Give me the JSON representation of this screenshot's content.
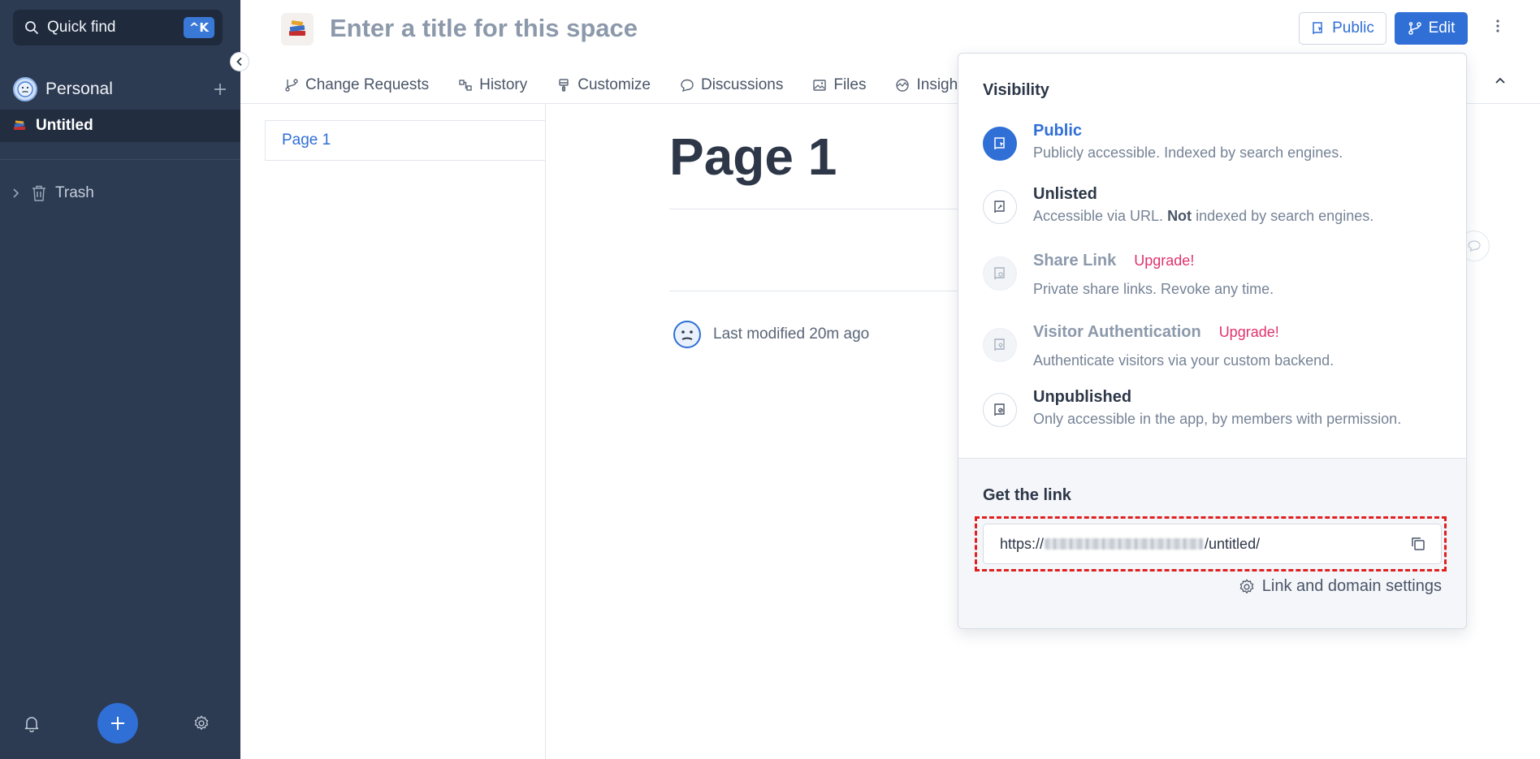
{
  "sidebar": {
    "quick_find": "Quick find",
    "shortcut": "^K",
    "section_name": "Personal",
    "item_untitled": "Untitled",
    "trash": "Trash"
  },
  "header": {
    "title_placeholder": "Enter a title for this space",
    "public_button": "Public",
    "edit_button": "Edit"
  },
  "tabs": [
    {
      "label": "Change Requests",
      "icon": "branch-icon"
    },
    {
      "label": "History",
      "icon": "history-icon"
    },
    {
      "label": "Customize",
      "icon": "brush-icon"
    },
    {
      "label": "Discussions",
      "icon": "chat-icon"
    },
    {
      "label": "Files",
      "icon": "image-icon"
    },
    {
      "label": "Insigh",
      "icon": "insights-icon"
    }
  ],
  "page_tree": {
    "item": "Page 1"
  },
  "content": {
    "heading": "Page 1",
    "last_modified": "Last modified 20m ago"
  },
  "visibility": {
    "heading": "Visibility",
    "options": [
      {
        "title": "Public",
        "desc": "Publicly accessible. Indexed by search engines.",
        "state": "active"
      },
      {
        "title": "Unlisted",
        "desc_pre": "Accessible via URL. ",
        "desc_bold": "Not",
        "desc_post": " indexed by search engines.",
        "state": "normal"
      },
      {
        "title": "Share Link",
        "badge": "Upgrade!",
        "desc": "Private share links. Revoke any time.",
        "state": "disabled"
      },
      {
        "title": "Visitor Authentication",
        "badge": "Upgrade!",
        "desc": "Authenticate visitors via your custom backend.",
        "state": "disabled"
      },
      {
        "title": "Unpublished",
        "desc": "Only accessible in the app, by members with permission.",
        "state": "normal"
      }
    ],
    "link_heading": "Get the link",
    "link_prefix": "https://",
    "link_suffix": "/untitled/",
    "link_settings": "Link and domain settings"
  },
  "colors": {
    "sidebar_bg": "#2c3a52",
    "accent": "#2f6fd6",
    "upgrade": "#e0326e",
    "highlight": "#e02020"
  }
}
